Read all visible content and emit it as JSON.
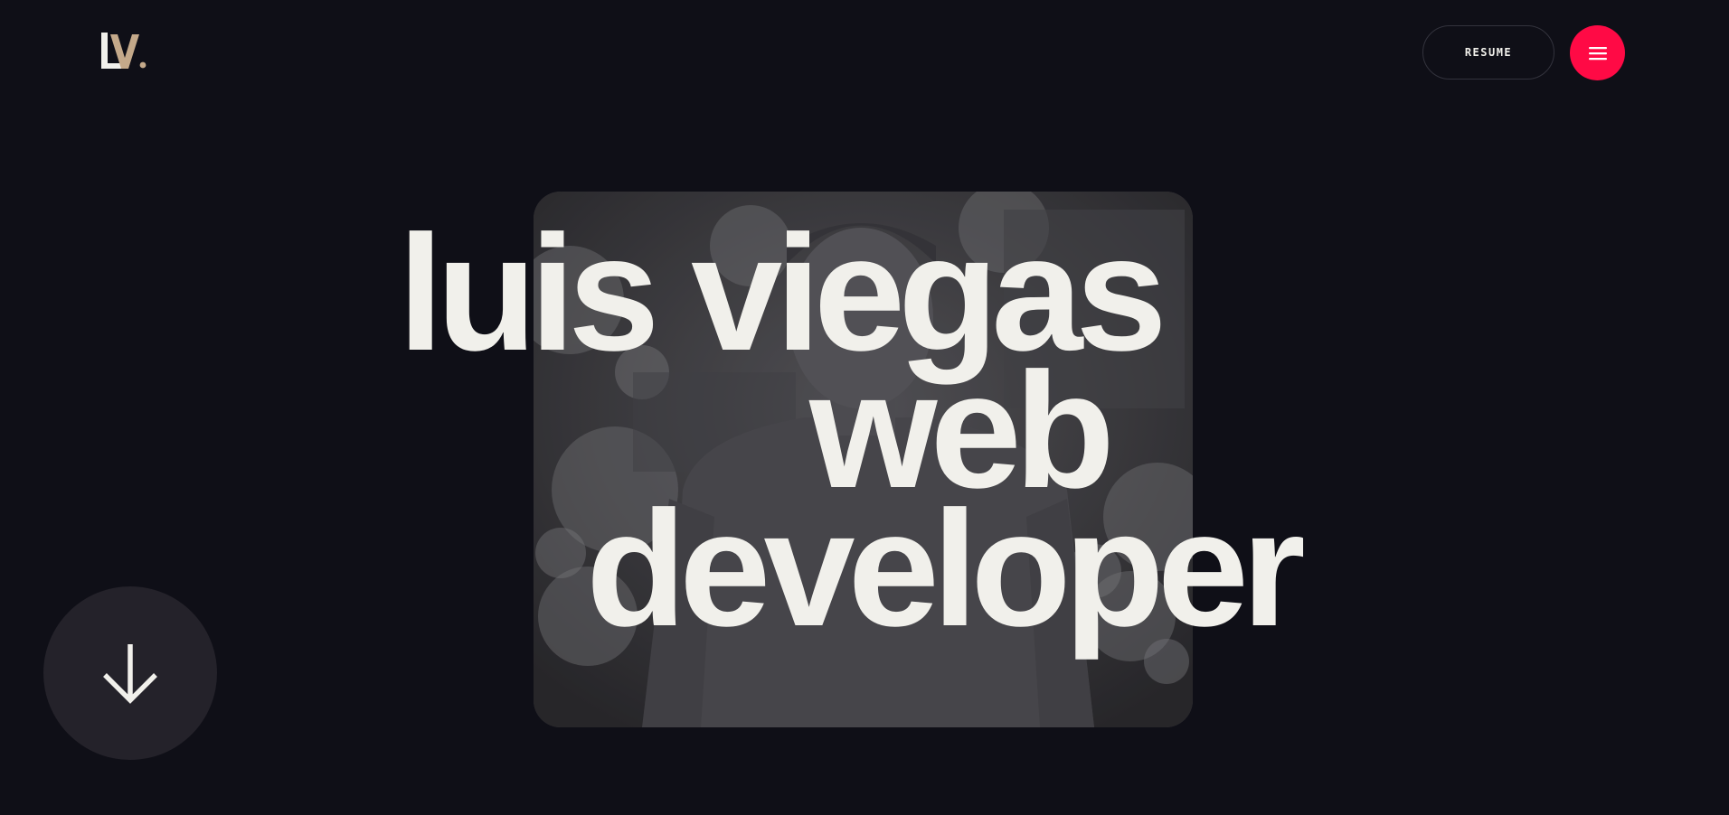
{
  "header": {
    "logo": {
      "letters": "LV.",
      "colors": {
        "l": "#f1f0eb",
        "v": "#c4a98a",
        "dot": "#c4a98a"
      }
    },
    "resume_label": "RESUME",
    "menu_icon": "hamburger-icon"
  },
  "hero": {
    "line_1": "luis viegas",
    "line_2": "web",
    "line_3": "developer",
    "photo_description_icon": "portrait-photo"
  },
  "scroll_button": {
    "icon": "arrow-down-icon"
  },
  "colors": {
    "background": "#0f0f17",
    "text": "#f1f0eb",
    "accent": "#ff0a45",
    "scroll_button_bg": "#24222a"
  }
}
